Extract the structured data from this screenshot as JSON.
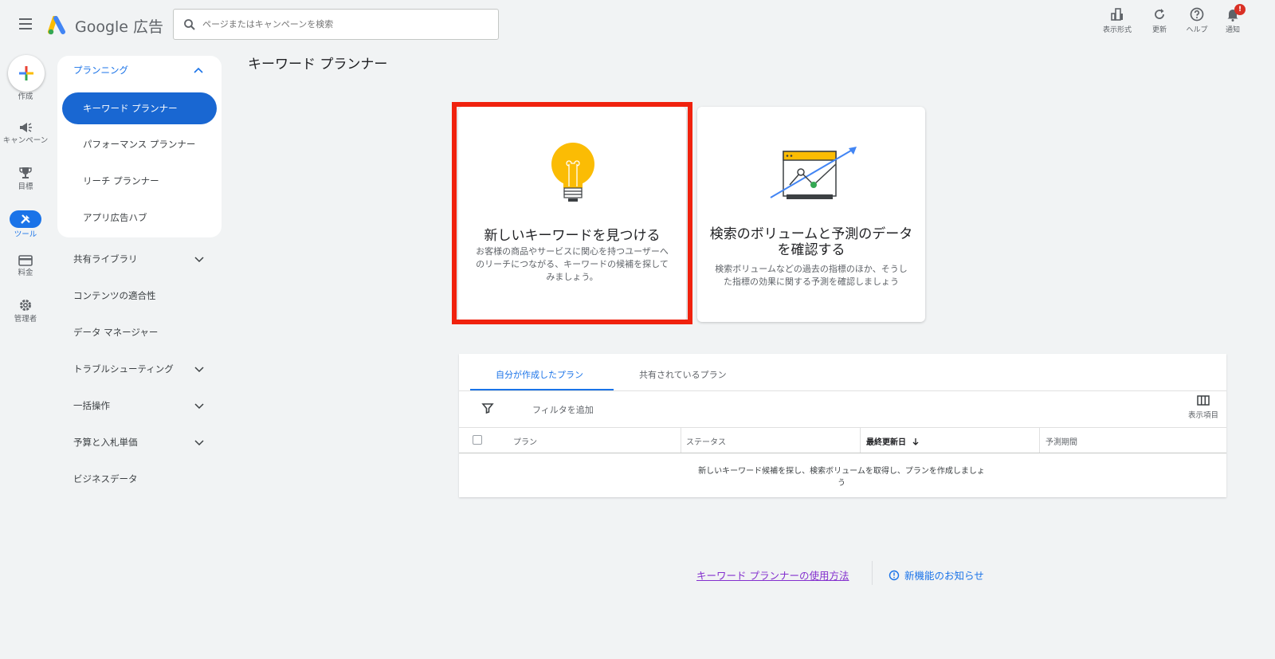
{
  "header": {
    "logo_text": "Google 広告",
    "search_placeholder": "ページまたはキャンペーンを検索",
    "actions": [
      {
        "label": "表示形式",
        "icon": "view-format-icon"
      },
      {
        "label": "更新",
        "icon": "refresh-icon"
      },
      {
        "label": "ヘルプ",
        "icon": "help-icon"
      },
      {
        "label": "通知",
        "icon": "bell-icon",
        "badge": "!"
      }
    ]
  },
  "rail": {
    "create_label": "作成",
    "items": [
      {
        "label": "キャンペーン",
        "icon": "megaphone-icon"
      },
      {
        "label": "目標",
        "icon": "trophy-icon"
      },
      {
        "label": "ツール",
        "icon": "tools-icon",
        "active": true
      },
      {
        "label": "料金",
        "icon": "credit-card-icon"
      },
      {
        "label": "管理者",
        "icon": "gear-icon"
      }
    ]
  },
  "nav": {
    "section_title": "プランニング",
    "sub_items": [
      {
        "label": "キーワード プランナー",
        "active": true
      },
      {
        "label": "パフォーマンス プランナー"
      },
      {
        "label": "リーチ プランナー"
      },
      {
        "label": "アプリ広告ハブ"
      }
    ],
    "items": [
      {
        "label": "共有ライブラリ",
        "expandable": true
      },
      {
        "label": "コンテンツの適合性",
        "expandable": false
      },
      {
        "label": "データ マネージャー",
        "expandable": false
      },
      {
        "label": "トラブルシューティング",
        "expandable": true
      },
      {
        "label": "一括操作",
        "expandable": true
      },
      {
        "label": "予算と入札単価",
        "expandable": true
      },
      {
        "label": "ビジネスデータ",
        "expandable": false
      }
    ]
  },
  "main": {
    "title": "キーワード プランナー",
    "cards": [
      {
        "title": "新しいキーワードを見つける",
        "description": "お客様の商品やサービスに関心を持つユーザーへのリーチにつながる、キーワードの候補を探してみましょう。",
        "icon": "lightbulb-icon",
        "highlighted": true
      },
      {
        "title": "検索のボリュームと予測のデータを確認する",
        "description": "検索ボリュームなどの過去の指標のほか、そうした指標の効果に関する予測を確認しましょう",
        "icon": "forecast-chart-icon"
      }
    ],
    "plans": {
      "tabs": [
        {
          "label": "自分が作成したプラン",
          "active": true
        },
        {
          "label": "共有されているプラン"
        }
      ],
      "filter_label": "フィルタを追加",
      "columns_label": "表示項目",
      "columns": [
        "プラン",
        "ステータス",
        "最終更新日",
        "予測期間"
      ],
      "sorted_column": "最終更新日",
      "empty_message": "新しいキーワード候補を探し、検索ボリュームを取得し、プランを作成しましょう"
    }
  },
  "footer": {
    "howto_link": "キーワード プランナーの使用方法",
    "news_link": "新機能のお知らせ"
  },
  "colors": {
    "accent": "#1a73e8",
    "highlight_border": "#f0220e",
    "background": "#f1f3f4",
    "bulb": "#fbbc04"
  }
}
